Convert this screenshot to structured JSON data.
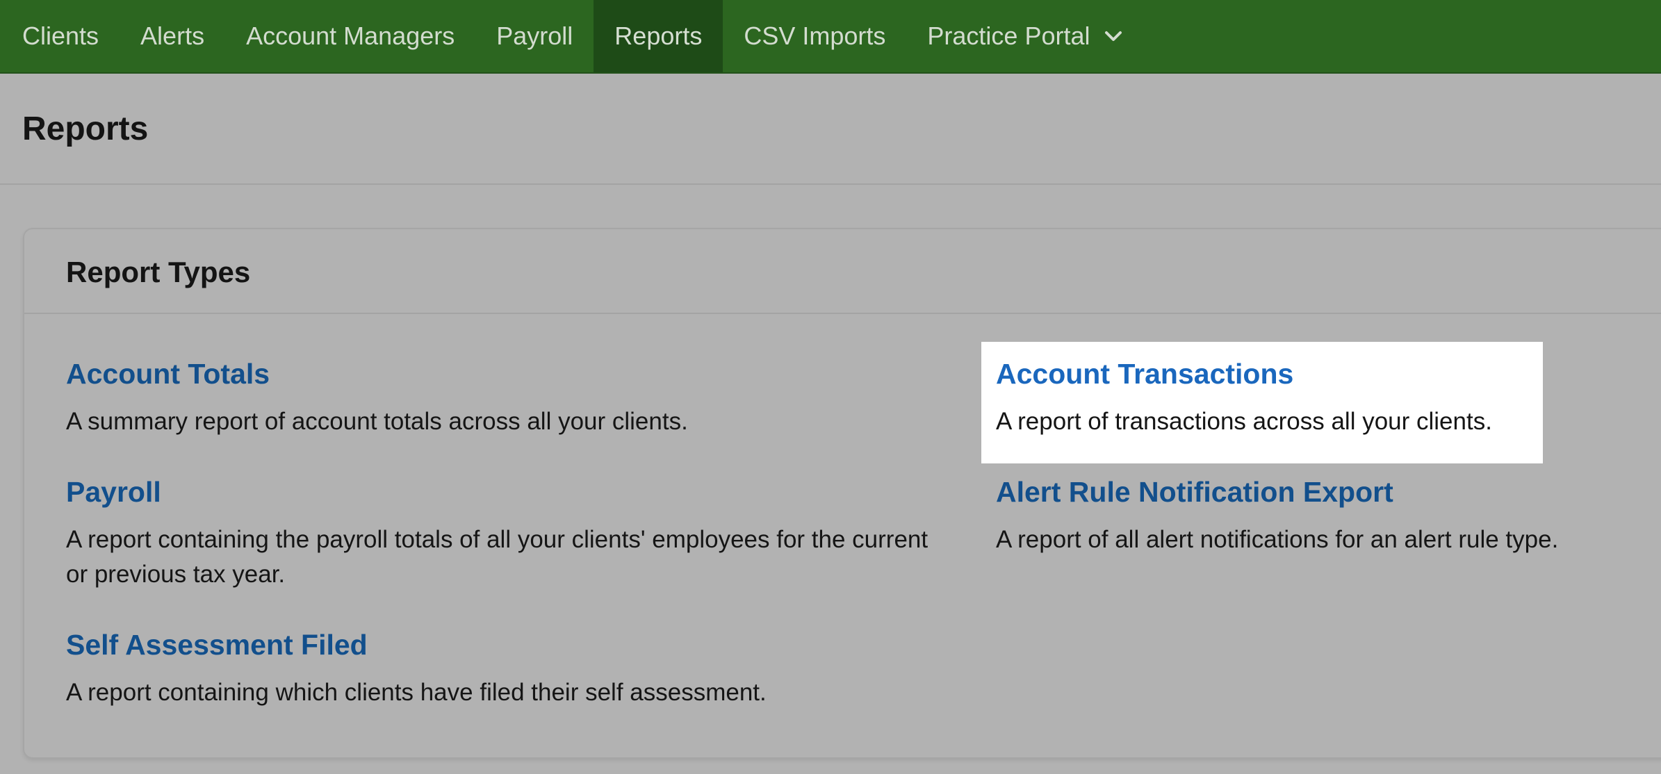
{
  "nav": {
    "items": [
      {
        "label": "Clients"
      },
      {
        "label": "Alerts"
      },
      {
        "label": "Account Managers"
      },
      {
        "label": "Payroll"
      },
      {
        "label": "Reports",
        "active": true
      },
      {
        "label": "CSV Imports"
      },
      {
        "label": "Practice Portal",
        "dropdown": true
      }
    ],
    "colors": {
      "bar": "#2c6620",
      "active": "#1e4b17"
    }
  },
  "page": {
    "title": "Reports"
  },
  "card": {
    "title": "Report Types",
    "reports": [
      {
        "title": "Account Totals",
        "description": "A summary report of account totals across all your clients."
      },
      {
        "title": "Account Transactions",
        "description": "A report of transactions across all your clients.",
        "highlighted": true
      },
      {
        "title": "Payroll",
        "description": "A report containing the payroll totals of all your clients' employees for the current or previous tax year."
      },
      {
        "title": "Alert Rule Notification Export",
        "description": "A report of all alert notifications for an alert rule type."
      },
      {
        "title": "Self Assessment Filed",
        "description": "A report containing which clients have filed their self assessment."
      }
    ]
  },
  "icons": {
    "practice_portal_dropdown": "chevron-down-icon"
  },
  "colors": {
    "link": "#124f8c",
    "link_highlighted": "#1a67bd",
    "background": "#b2b2b2"
  }
}
